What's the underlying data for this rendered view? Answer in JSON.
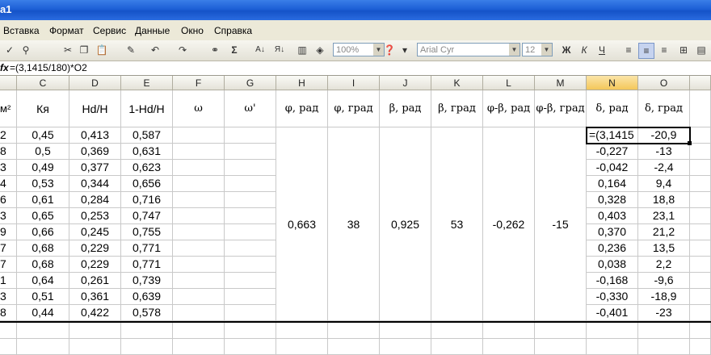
{
  "title": "a1",
  "menu": [
    "Вставка",
    "Формат",
    "Сервис",
    "Данные",
    "Окно",
    "Справка"
  ],
  "toolbar": {
    "zoom": "100%",
    "font": "Arial Cyr",
    "size": "12",
    "bold": "Ж",
    "italic": "К",
    "underline": "Ч",
    "sum": "Σ"
  },
  "formula_bar": {
    "fx": "fx",
    "formula": "=(3,1415/180)*O2"
  },
  "columns": [
    "C",
    "D",
    "E",
    "F",
    "G",
    "H",
    "I",
    "J",
    "K",
    "L",
    "M",
    "N",
    "O"
  ],
  "header_row": {
    "a_partial": "м²",
    "C": "Кя",
    "D": "Hd/H",
    "E": "1-Hd/H",
    "F": "ω",
    "G": "ω'",
    "H": "φ, рад",
    "I": "φ, град",
    "J": "β, рад",
    "K": "β, град",
    "L": "φ-β, рад",
    "M": "φ-β, град",
    "N": "δ, рад",
    "O": "δ, град"
  },
  "rows": [
    {
      "a": "2",
      "C": "0,45",
      "D": "0,413",
      "E": "0,587",
      "N": "=(3,1415",
      "O": "-20,9"
    },
    {
      "a": "8",
      "C": "0,5",
      "D": "0,369",
      "E": "0,631",
      "N": "-0,227",
      "O": "-13"
    },
    {
      "a": "3",
      "C": "0,49",
      "D": "0,377",
      "E": "0,623",
      "N": "-0,042",
      "O": "-2,4"
    },
    {
      "a": "4",
      "C": "0,53",
      "D": "0,344",
      "E": "0,656",
      "N": "0,164",
      "O": "9,4"
    },
    {
      "a": "6",
      "C": "0,61",
      "D": "0,284",
      "E": "0,716",
      "N": "0,328",
      "O": "18,8"
    },
    {
      "a": "3",
      "C": "0,65",
      "D": "0,253",
      "E": "0,747",
      "N": "0,403",
      "O": "23,1"
    },
    {
      "a": "9",
      "C": "0,66",
      "D": "0,245",
      "E": "0,755",
      "N": "0,370",
      "O": "21,2"
    },
    {
      "a": "7",
      "C": "0,68",
      "D": "0,229",
      "E": "0,771",
      "N": "0,236",
      "O": "13,5"
    },
    {
      "a": "7",
      "C": "0,68",
      "D": "0,229",
      "E": "0,771",
      "N": "0,038",
      "O": "2,2"
    },
    {
      "a": "1",
      "C": "0,64",
      "D": "0,261",
      "E": "0,739",
      "N": "-0,168",
      "O": "-9,6"
    },
    {
      "a": "3",
      "C": "0,51",
      "D": "0,361",
      "E": "0,639",
      "N": "-0,330",
      "O": "-18,9"
    },
    {
      "a": "8",
      "C": "0,44",
      "D": "0,422",
      "E": "0,578",
      "N": "-0,401",
      "O": "-23"
    }
  ],
  "merged": {
    "H": "0,663",
    "I": "38",
    "J": "0,925",
    "K": "53",
    "L": "-0,262",
    "M": "-15"
  }
}
